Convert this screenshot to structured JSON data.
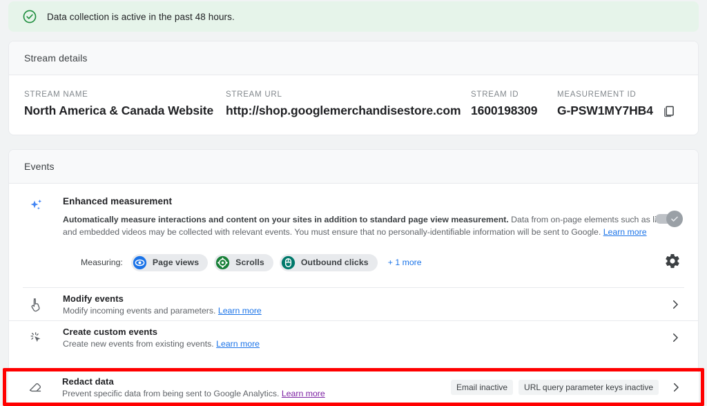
{
  "banner": {
    "icon": "check-circle-icon",
    "text": "Data collection is active in the past 48 hours.",
    "background": "#e6f4ea",
    "icon_color": "#1e8e3e"
  },
  "stream_details": {
    "header": "Stream details",
    "fields": [
      {
        "label": "STREAM NAME",
        "value": "North America & Canada Website"
      },
      {
        "label": "STREAM URL",
        "value": "http://shop.googlemerchandisestore.com"
      },
      {
        "label": "STREAM ID",
        "value": "1600198309"
      },
      {
        "label": "MEASUREMENT ID",
        "value": "G-PSW1MY7HB4",
        "copy_icon": "copy-icon"
      }
    ]
  },
  "events": {
    "header": "Events",
    "enhanced_measurement": {
      "icon": "sparkle-icon",
      "title": "Enhanced measurement",
      "desc_bold": "Automatically measure interactions and content on your sites in addition to standard page view measurement.",
      "desc_rest": "Data from on-page elements such as links and embedded videos may be collected with relevant events. You must ensure that no personally-identifiable information will be sent to Google. ",
      "learn_more": "Learn more",
      "toggle_on": true,
      "toggle_disabled": true,
      "measuring_label": "Measuring:",
      "chips": [
        {
          "label": "Page views",
          "icon": "eye-icon",
          "color": "#1a73e8"
        },
        {
          "label": "Scrolls",
          "icon": "scroll-icon",
          "color": "#188038"
        },
        {
          "label": "Outbound clicks",
          "icon": "mouse-icon",
          "color": "#00796b"
        }
      ],
      "more_label": "+ 1 more",
      "settings_icon": "gear-icon"
    },
    "rows": [
      {
        "icon": "tap-hand-icon",
        "title": "Modify events",
        "subtitle": "Modify incoming events and parameters. ",
        "learn_more": "Learn more",
        "learn_more_visited": false,
        "badges": [],
        "chevron": "chevron-right-icon"
      },
      {
        "icon": "cursor-sparkle-icon",
        "title": "Create custom events",
        "subtitle": "Create new events from existing events. ",
        "learn_more": "Learn more",
        "learn_more_visited": false,
        "badges": [],
        "chevron": "chevron-right-icon"
      }
    ],
    "redact_row": {
      "icon": "eraser-icon",
      "title": "Redact data",
      "subtitle": "Prevent specific data from being sent to Google Analytics. ",
      "learn_more": "Learn more",
      "learn_more_visited": true,
      "badges": [
        "Email inactive",
        "URL query parameter keys inactive"
      ],
      "chevron": "chevron-right-icon",
      "highlight_color": "#ff0000"
    }
  }
}
